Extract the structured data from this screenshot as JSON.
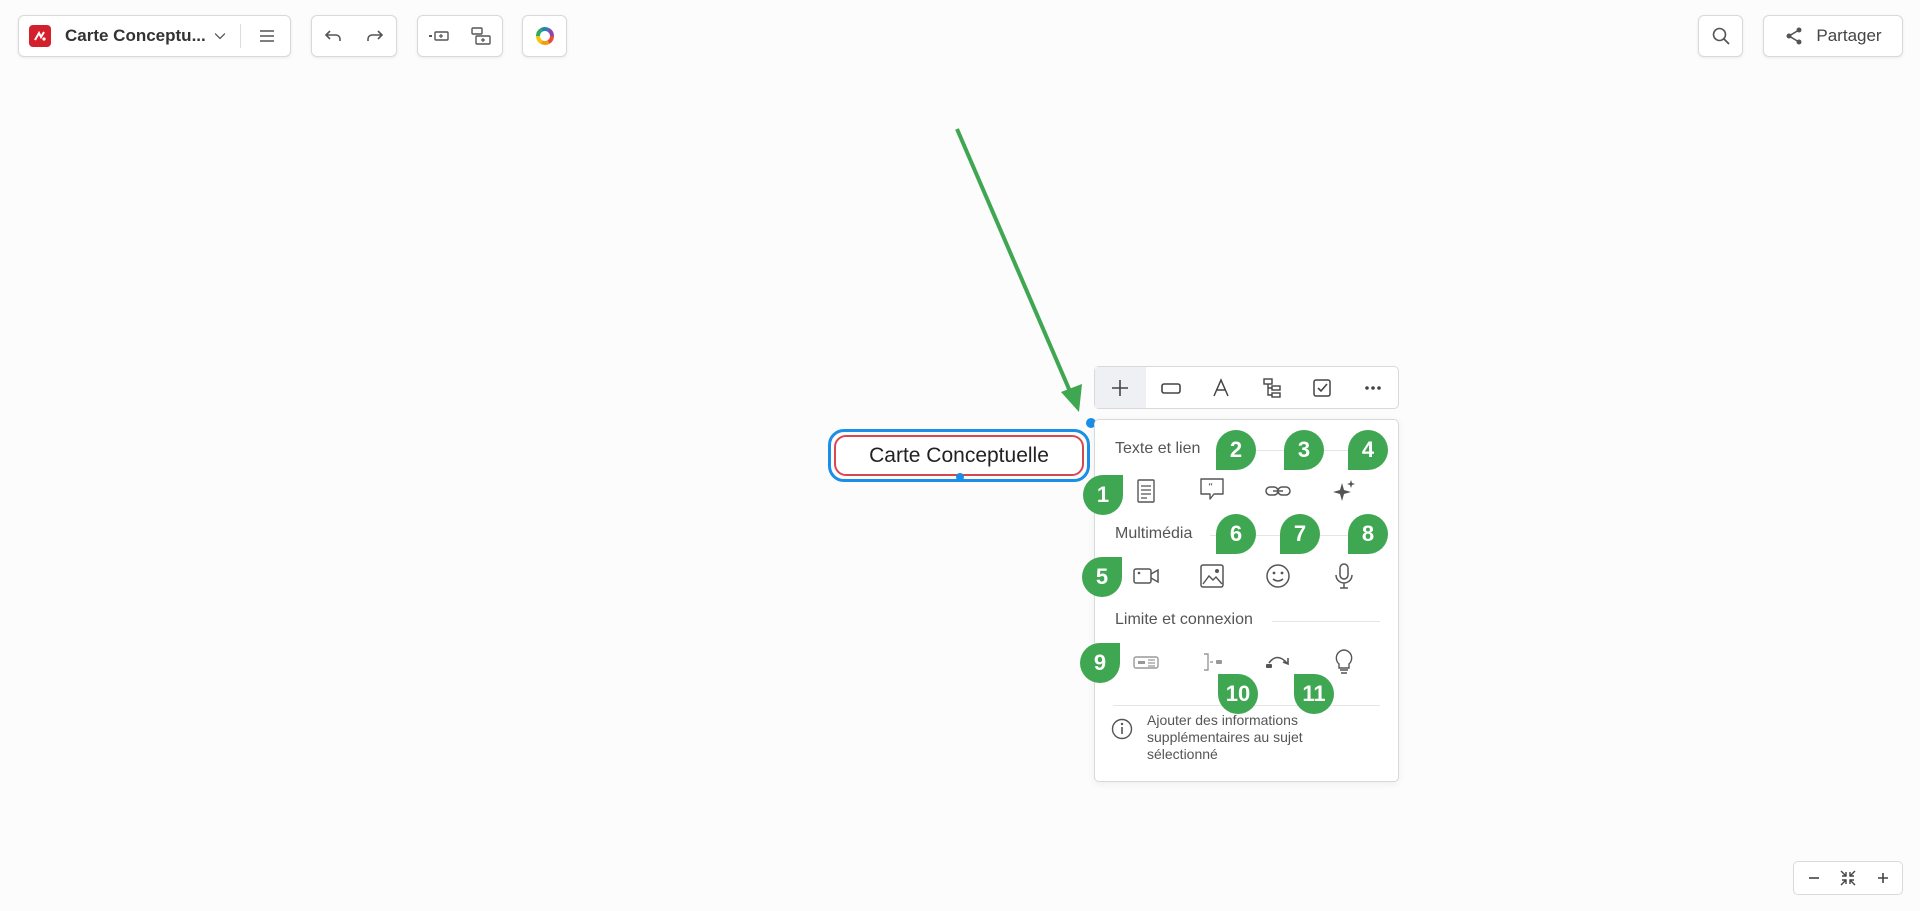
{
  "toolbar": {
    "file_title": "Carte Conceptu...",
    "share_label": "Partager"
  },
  "canvas": {
    "central_topic": "Carte Conceptuelle"
  },
  "panel": {
    "section_text_link": "Texte et lien",
    "section_multimedia": "Multimédia",
    "section_boundary": "Limite et connexion",
    "info_text": "Ajouter des informations supplémentaires au sujet sélectionné"
  },
  "annotations": [
    "1",
    "2",
    "3",
    "4",
    "5",
    "6",
    "7",
    "8",
    "9",
    "10",
    "11"
  ],
  "colors": {
    "accent_blue": "#1b8ee8",
    "topic_border": "#d64850",
    "annotation_green": "#3fa651",
    "brand_red": "#d4202c"
  }
}
